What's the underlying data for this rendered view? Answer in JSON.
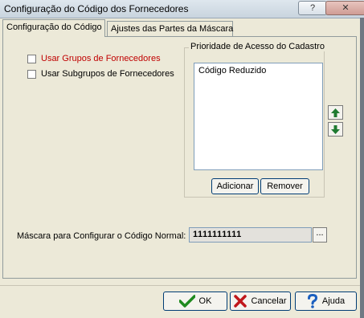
{
  "window": {
    "title": "Configuração do Código dos Fornecedores",
    "help_label": "?",
    "close_label": "✕"
  },
  "tabs": [
    {
      "label": "Configuração do Código",
      "active": true
    },
    {
      "label": "Ajustes das Partes da Máscara",
      "active": false
    }
  ],
  "options": {
    "use_groups": {
      "label": "Usar Grupos de Fornecedores",
      "checked": false,
      "color": "#c00000"
    },
    "use_subgroups": {
      "label": "Usar Subgrupos de Fornecedores",
      "checked": false
    }
  },
  "priority": {
    "group_label": "Prioridade de Acesso do Cadastro",
    "items": [
      "Código Reduzido"
    ],
    "add_label": "Adicionar",
    "remove_label": "Remover",
    "up_icon": "arrow-up-icon",
    "down_icon": "arrow-down-icon"
  },
  "mask": {
    "label": "Máscara para Configurar o Código Normal:",
    "value": "1111111111",
    "browse_label": "..."
  },
  "footer": {
    "ok_label": "OK",
    "cancel_label": "Cancelar",
    "help_label": "Ajuda"
  },
  "colors": {
    "accent": "#003c74",
    "ok_check": "#1f8a1f",
    "cancel_x": "#c0171b",
    "help_q": "#1b5fbf",
    "arrows": "#1f7a30"
  }
}
